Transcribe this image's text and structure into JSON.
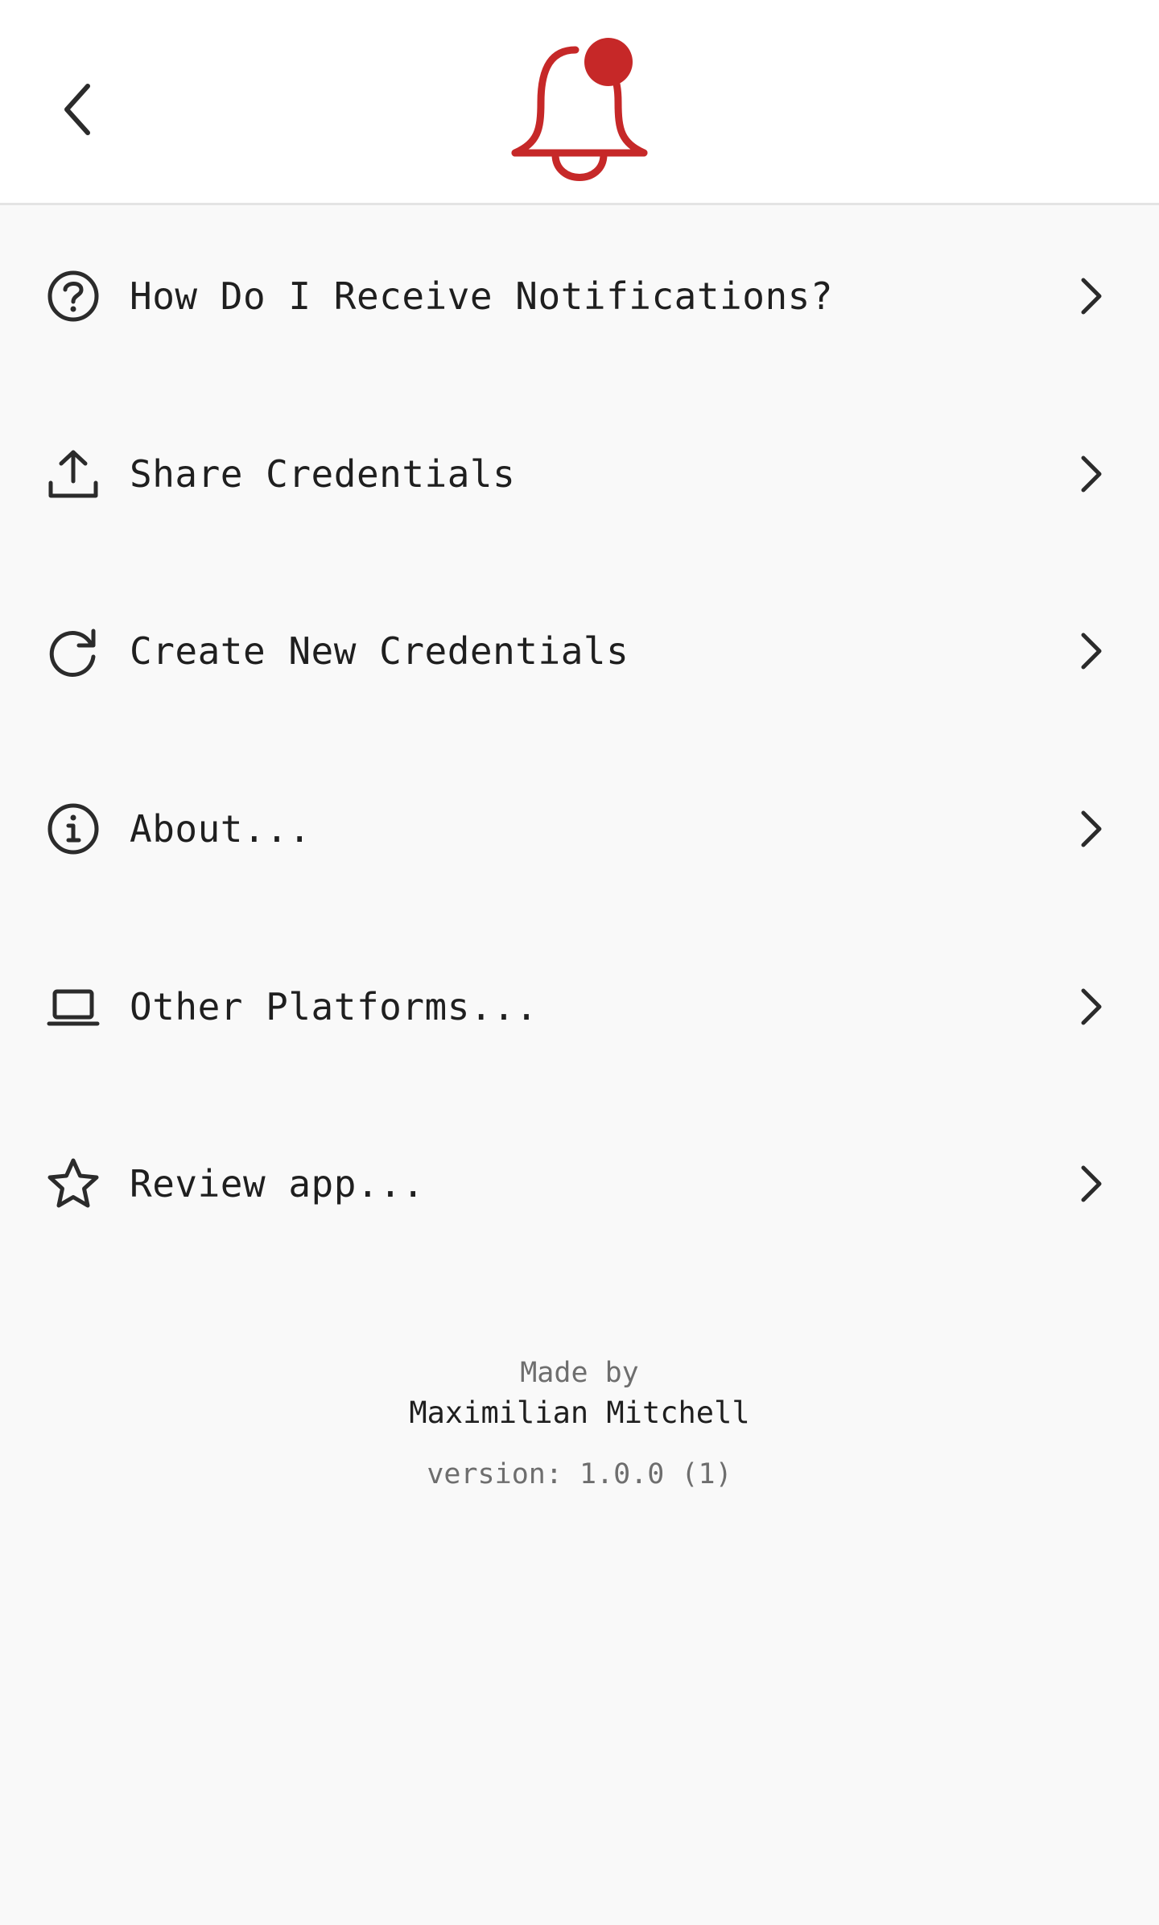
{
  "header": {
    "back_icon": "chevron-left-icon",
    "logo_icon": "notification-bell-icon",
    "logo_color": "#c62828"
  },
  "menu": {
    "items": [
      {
        "label": "How Do I Receive Notifications?",
        "icon": "question-circle-icon"
      },
      {
        "label": "Share Credentials",
        "icon": "upload-icon"
      },
      {
        "label": "Create New Credentials",
        "icon": "refresh-icon"
      },
      {
        "label": "About...",
        "icon": "info-circle-icon"
      },
      {
        "label": "Other Platforms...",
        "icon": "laptop-icon"
      },
      {
        "label": "Review app...",
        "icon": "star-icon"
      }
    ]
  },
  "footer": {
    "made_by_label": "Made by",
    "author": "Maximilian Mitchell",
    "version": "version: 1.0.0 (1)"
  }
}
